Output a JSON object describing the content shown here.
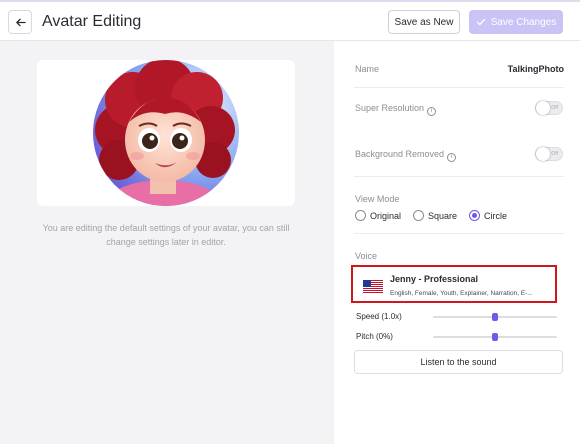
{
  "header": {
    "title": "Avatar Editing",
    "save_new_label": "Save as New",
    "save_changes_label": "Save Changes",
    "accent": "#6c5ce7",
    "accent_disabled": "#c9c3f6"
  },
  "left": {
    "hint": "You are editing the default settings of your avatar, you can still change settings later in editor."
  },
  "settings": {
    "name_label": "Name",
    "name_value": "TalkingPhoto",
    "super_resolution_label": "Super Resolution",
    "super_resolution_state": "Off",
    "background_removed_label": "Background Removed",
    "background_removed_state": "Off",
    "view_mode_label": "View Mode",
    "view_modes": [
      "Original",
      "Square",
      "Circle"
    ],
    "view_mode_selected": "Circle",
    "voice_label": "Voice",
    "voice": {
      "flag": "us-flag-icon",
      "name": "Jenny - Professional",
      "description": "English, Female, Youth, Explainer, Narration, E-..."
    },
    "speed_label": "Speed (1.0x)",
    "speed_value": 0.5,
    "pitch_label": "Pitch (0%)",
    "pitch_value": 0.5,
    "listen_label": "Listen to the sound"
  }
}
